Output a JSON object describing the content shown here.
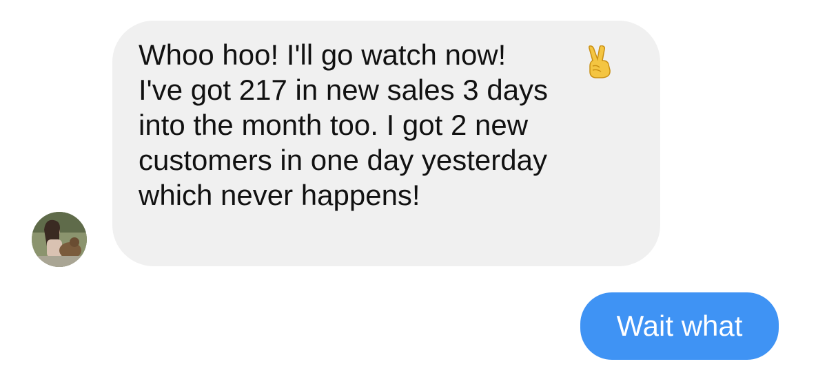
{
  "conversation": {
    "incoming_message": {
      "text": "Whoo hoo! I'll go watch now!\nI've got 217 in new sales 3 days\ninto the month too. I got 2 new\ncustomers in one day yesterday\nwhich never happens!",
      "emoji": "victory-hand",
      "bubble_color": "#f0f0f0"
    },
    "outgoing_message": {
      "text": "Wait what",
      "bubble_color": "#3f93f4"
    }
  }
}
